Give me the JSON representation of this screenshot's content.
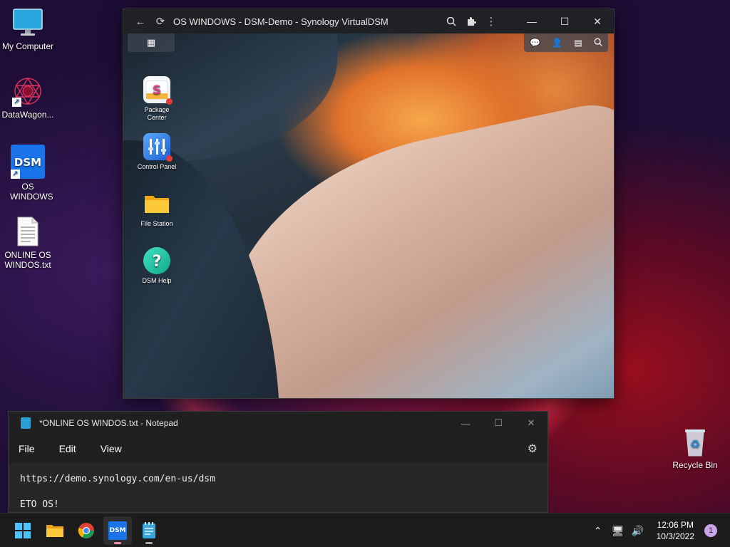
{
  "desktop": {
    "icons": [
      {
        "label": "My Computer"
      },
      {
        "label": "DataWagon..."
      },
      {
        "label": "OS WINDOWS"
      },
      {
        "label": "ONLINE OS WINDOS.txt"
      },
      {
        "label": "Recycle Bin"
      }
    ]
  },
  "dsm_window": {
    "title": "OS WINDOWS - DSM-Demo - Synology VirtualDSM",
    "apps": [
      {
        "label": "Package Center",
        "badge": true
      },
      {
        "label": "Control Panel",
        "badge": true
      },
      {
        "label": "File Station",
        "badge": false
      },
      {
        "label": "DSM Help",
        "badge": false
      }
    ],
    "logo_text": "DSM"
  },
  "notepad": {
    "title": "*ONLINE OS WINDOS.txt - Notepad",
    "menu": [
      "File",
      "Edit",
      "View"
    ],
    "lines": [
      "https://demo.synology.com/en-us/dsm",
      "ETO OS!"
    ]
  },
  "taskbar": {
    "time": "12:06 PM",
    "date": "10/3/2022",
    "notification_count": "1",
    "dsm_label": "DSM"
  },
  "colors": {
    "accent_blue": "#1a73e8",
    "taskbar_bg": "#1c1c1c",
    "badge_red": "#e53935"
  }
}
